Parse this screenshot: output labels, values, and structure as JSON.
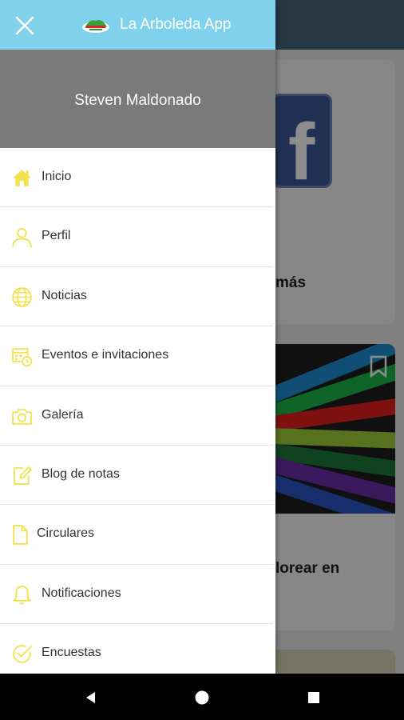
{
  "header": {
    "app_title": "La Arboleda App"
  },
  "user": {
    "name": "Steven Maldonado"
  },
  "menu": [
    {
      "label": "Inicio",
      "icon": "home-icon"
    },
    {
      "label": "Perfil",
      "icon": "user-icon"
    },
    {
      "label": "Noticias",
      "icon": "globe-icon"
    },
    {
      "label": "Eventos e invitaciones",
      "icon": "calendar-clock-icon"
    },
    {
      "label": "Galería",
      "icon": "camera-icon"
    },
    {
      "label": "Blog de notas",
      "icon": "edit-icon"
    },
    {
      "label": "Circulares",
      "icon": "file-icon"
    },
    {
      "label": "Notificaciones",
      "icon": "bell-icon"
    },
    {
      "label": "Encuestas",
      "icon": "check-circle-icon"
    }
  ],
  "background": {
    "card1_text": "más",
    "card2_text": "lorear en"
  },
  "colors": {
    "header": "#80d2ec",
    "icon_yellow": "#f3e24f",
    "user_area": "#7a7a7a"
  }
}
